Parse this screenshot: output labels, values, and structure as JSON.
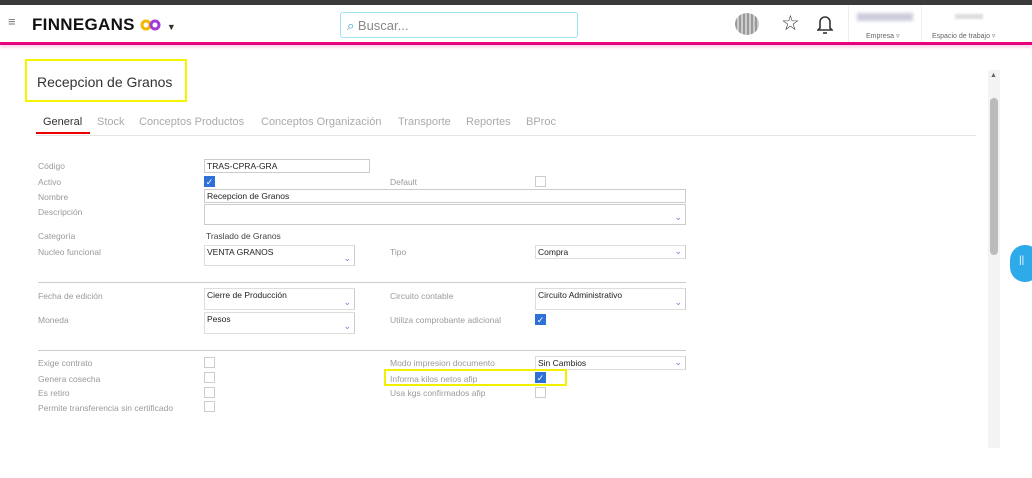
{
  "header": {
    "brand": "FINNEGANS",
    "search_placeholder": "Buscar...",
    "empresa_label": "Empresa ▿",
    "espacio_label": "Espacio de trabajo ▿"
  },
  "page": {
    "title": "Recepcion de Granos"
  },
  "tabs": [
    "General",
    "Stock",
    "Conceptos Productos",
    "Conceptos Organización",
    "Transporte",
    "Reportes",
    "BProc"
  ],
  "form": {
    "codigo": {
      "label": "Código",
      "value": "TRAS-CPRA-GRA"
    },
    "activo": {
      "label": "Activo",
      "checked": true
    },
    "default": {
      "label": "Default",
      "checked": false
    },
    "nombre": {
      "label": "Nombre",
      "value": "Recepcion de Granos"
    },
    "descripcion": {
      "label": "Descripción",
      "value": ""
    },
    "categoria": {
      "label": "Categoría",
      "value": "Traslado de Granos"
    },
    "nucleo": {
      "label": "Nucleo funcional",
      "value": "VENTA GRANOS"
    },
    "tipo": {
      "label": "Tipo",
      "value": "Compra"
    },
    "fecha": {
      "label": "Fecha de edición",
      "value": "Cierre de Producción"
    },
    "circuito": {
      "label": "Circuito contable",
      "value": "Circuito Administrativo"
    },
    "moneda": {
      "label": "Moneda",
      "value": "Pesos"
    },
    "utiliza": {
      "label": "Utiliza comprobante adicional",
      "checked": true
    },
    "exige": {
      "label": "Exige contrato",
      "checked": false
    },
    "modo": {
      "label": "Modo impresion documento",
      "value": "Sin Cambios"
    },
    "genera": {
      "label": "Genera cosecha",
      "checked": false
    },
    "informa": {
      "label": "Informa kilos netos afip",
      "checked": true
    },
    "retiro": {
      "label": "Es retiro",
      "checked": false
    },
    "usakgs": {
      "label": "Usa kgs confirmados afip",
      "checked": false
    },
    "permite": {
      "label": "Permite transferencia sin certificado",
      "checked": false
    }
  }
}
